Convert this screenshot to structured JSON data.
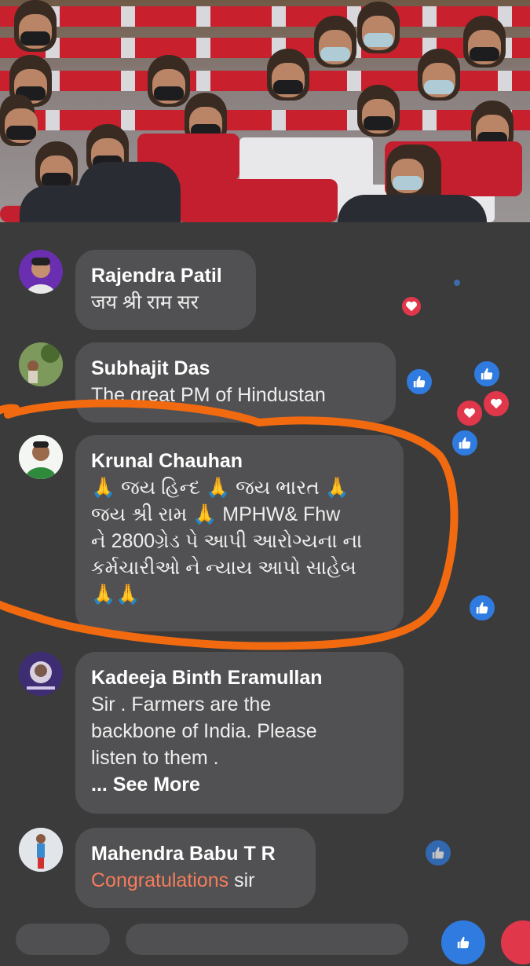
{
  "comments": [
    {
      "name": "Rajendra Patil",
      "lines": [
        "जय श्री राम सर"
      ]
    },
    {
      "name": "Subhajit Das",
      "lines": [
        "The great PM of Hindustan"
      ]
    },
    {
      "name": "Krunal Chauhan",
      "lines": [
        "🙏 જય હિન્દ 🙏 જય ભારત 🙏",
        "જય શ્રી રામ 🙏  MPHW& Fhw",
        "ને 2800ગ્રેડ પે આપી આરોગ્યના ના",
        "કર્મચારીઓ ને ન્યાય આપો સાહેબ",
        "🙏🙏"
      ]
    },
    {
      "name": "Kadeeja Binth Eramullan",
      "lines": [
        "Sir .   Farmers are the",
        "backbone of India. Please",
        "listen to them ."
      ],
      "see_more": "... See More"
    },
    {
      "name": "Mahendra Babu T R",
      "highlight": "Congratulations",
      "rest": " sir"
    }
  ],
  "colors": {
    "background": "#3b3b3c",
    "bubble": "#515153",
    "like": "#2f7be0",
    "love": "#e0374a",
    "annotation": "#f26a10",
    "highlight": "#f57c5b"
  },
  "icons": {
    "like": "thumbs-up-icon",
    "love": "heart-icon"
  }
}
